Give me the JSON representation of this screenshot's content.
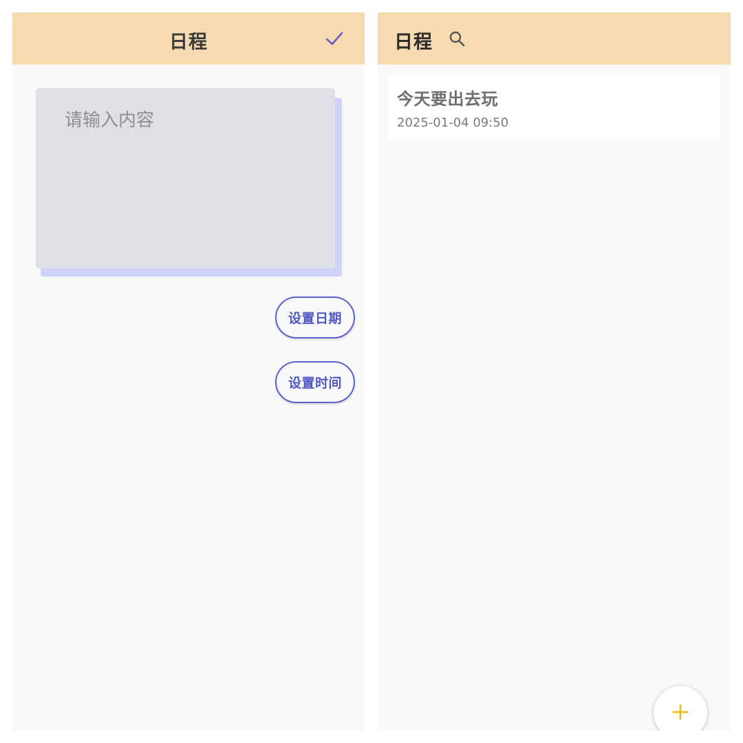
{
  "editor_screen": {
    "title": "日程",
    "confirm_icon": "check-icon",
    "content_placeholder": "请输入内容",
    "content_value": "",
    "set_date_label": "设置日期",
    "set_time_label": "设置时间"
  },
  "list_screen": {
    "title": "日程",
    "search_icon": "search-icon",
    "items": [
      {
        "title": "今天要出去玩",
        "datetime": "2025-01-04 09:50"
      }
    ],
    "add_icon": "plus-icon"
  },
  "colors": {
    "appbar": "#f6dab0",
    "accent": "#5c5fcf",
    "fab_plus": "#f2b90f"
  }
}
